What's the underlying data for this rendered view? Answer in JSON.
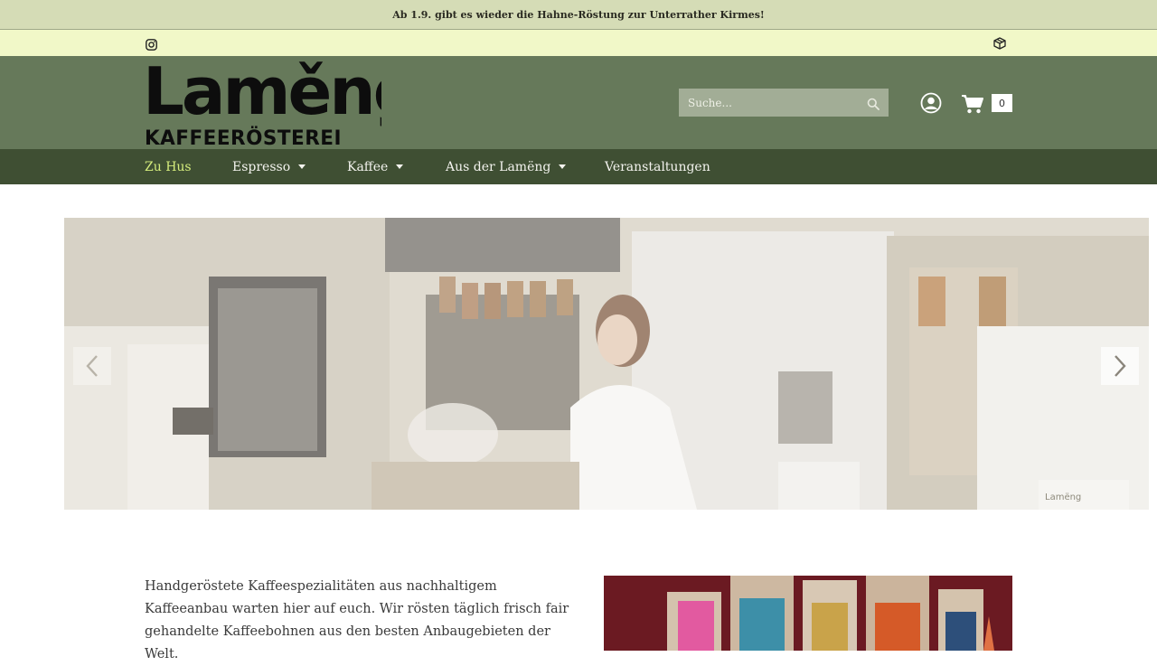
{
  "announcement": "Ab 1.9. gibt es wieder die Hahne-Röstung zur Unterrather Kirmes!",
  "social": {
    "instagram_icon": "instagram-icon",
    "package_icon": "package-icon"
  },
  "brand": {
    "name": "Laměng",
    "tagline": "KAFFEERÖSTEREI"
  },
  "search": {
    "placeholder": "Suche...",
    "icon": "search-icon"
  },
  "cart": {
    "count": "0",
    "icon": "cart-icon"
  },
  "account": {
    "icon": "user-circle-icon"
  },
  "nav": {
    "items": [
      {
        "label": "Zu Hus",
        "active": true,
        "dropdown": false
      },
      {
        "label": "Espresso",
        "active": false,
        "dropdown": true
      },
      {
        "label": "Kaffee",
        "active": false,
        "dropdown": true
      },
      {
        "label": "Aus der Lamëng",
        "active": false,
        "dropdown": true
      },
      {
        "label": "Veranstaltungen",
        "active": false,
        "dropdown": false
      }
    ]
  },
  "hero": {
    "sign_text": "Lamëng",
    "prev_icon": "chevron-left-icon",
    "next_icon": "chevron-right-icon"
  },
  "intro": {
    "text": "Handgeröstete Kaffeespezialitäten aus nachhaltigem Kaffeeanbau warten hier auf euch. Wir rösten täglich frisch fair gehandelte Kaffeebohnen aus den besten Anbaugebieten der Welt."
  },
  "colors": {
    "announcement_bg": "#d5dcb6",
    "social_bg": "#f1f8c8",
    "header_bg": "#66795a",
    "nav_bg": "#3f4f33",
    "nav_active": "#d4ec7c"
  }
}
